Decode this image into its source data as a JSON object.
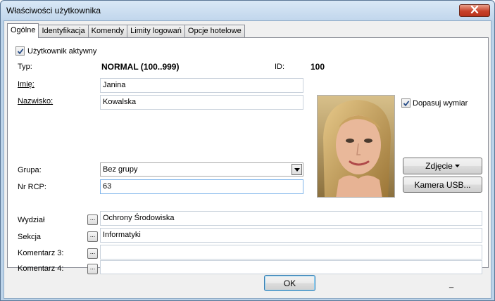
{
  "window": {
    "title": "Właściwości użytkownika"
  },
  "tabs": [
    {
      "label": "Ogólne",
      "active": true
    },
    {
      "label": "Identyfikacja",
      "active": false
    },
    {
      "label": "Komendy",
      "active": false
    },
    {
      "label": "Limity logowań",
      "active": false
    },
    {
      "label": "Opcje hotelowe",
      "active": false
    }
  ],
  "general": {
    "active_user": {
      "label": "Użytkownik aktywny",
      "checked": true
    },
    "type": {
      "label": "Typ:",
      "value": "NORMAL (100..999)"
    },
    "id": {
      "label": "ID:",
      "value": "100"
    },
    "first_name": {
      "label": "Imię:",
      "value": "Janina"
    },
    "last_name": {
      "label": "Nazwisko:",
      "value": "Kowalska"
    },
    "group": {
      "label": "Grupa:",
      "value": "Bez grupy"
    },
    "rcp": {
      "label": "Nr RCP:",
      "value": "63"
    },
    "fit_size": {
      "label": "Dopasuj wymiar",
      "checked": true
    },
    "photo_button": "Zdjęcie",
    "usb_camera_button": "Kamera USB...",
    "department": {
      "label": "Wydział",
      "value": "Ochrony Środowiska",
      "button": "..."
    },
    "section": {
      "label": "Sekcja",
      "value": "Informatyki",
      "button": "..."
    },
    "comment3": {
      "label": "Komentarz 3:",
      "value": "",
      "button": "..."
    },
    "comment4": {
      "label": "Komentarz 4:",
      "value": "",
      "button": "..."
    }
  },
  "footer": {
    "ok_label": "OK",
    "underscore_marker": "_"
  },
  "icons": {
    "close": "close-icon",
    "check": "checkmark-icon",
    "dropdown": "chevron-down-icon",
    "photo_menu": "triangle-down-icon",
    "photo": "user-photo"
  },
  "colors": {
    "title_bar": "#c1d6ec",
    "close_button": "#c8422a",
    "focus_border": "#7eb4ea",
    "ok_border": "#3c7fb1"
  }
}
